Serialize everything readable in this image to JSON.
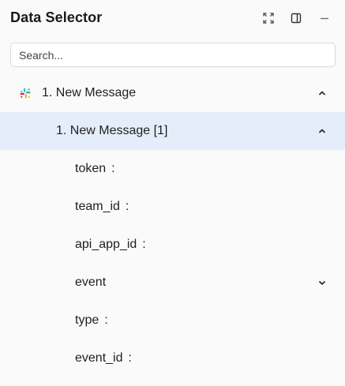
{
  "panel": {
    "title": "Data Selector",
    "header_icons": [
      "expand-icon",
      "sidebar-toggle-icon",
      "minimize-icon"
    ]
  },
  "search": {
    "placeholder": "Search...",
    "value": ""
  },
  "tree": {
    "root": {
      "label": "1. New Message",
      "icon": "slack-icon",
      "expanded": true
    },
    "child": {
      "label": "1. New Message [1]",
      "expanded": true,
      "selected": true
    },
    "fields": [
      {
        "label": "token",
        "separator": ":",
        "expandable": false
      },
      {
        "label": "team_id",
        "separator": ":",
        "expandable": false
      },
      {
        "label": "api_app_id",
        "separator": ":",
        "expandable": false
      },
      {
        "label": "event",
        "separator": "",
        "expandable": true
      },
      {
        "label": "type",
        "separator": ":",
        "expandable": false
      },
      {
        "label": "event_id",
        "separator": ":",
        "expandable": false
      }
    ]
  },
  "colors": {
    "selected_row": "#e5edfb",
    "background": "#fafafa",
    "slack_green": "#2eb67d",
    "slack_blue": "#36c5f0",
    "slack_yellow": "#ecb22e",
    "slack_red": "#e01e5a"
  }
}
